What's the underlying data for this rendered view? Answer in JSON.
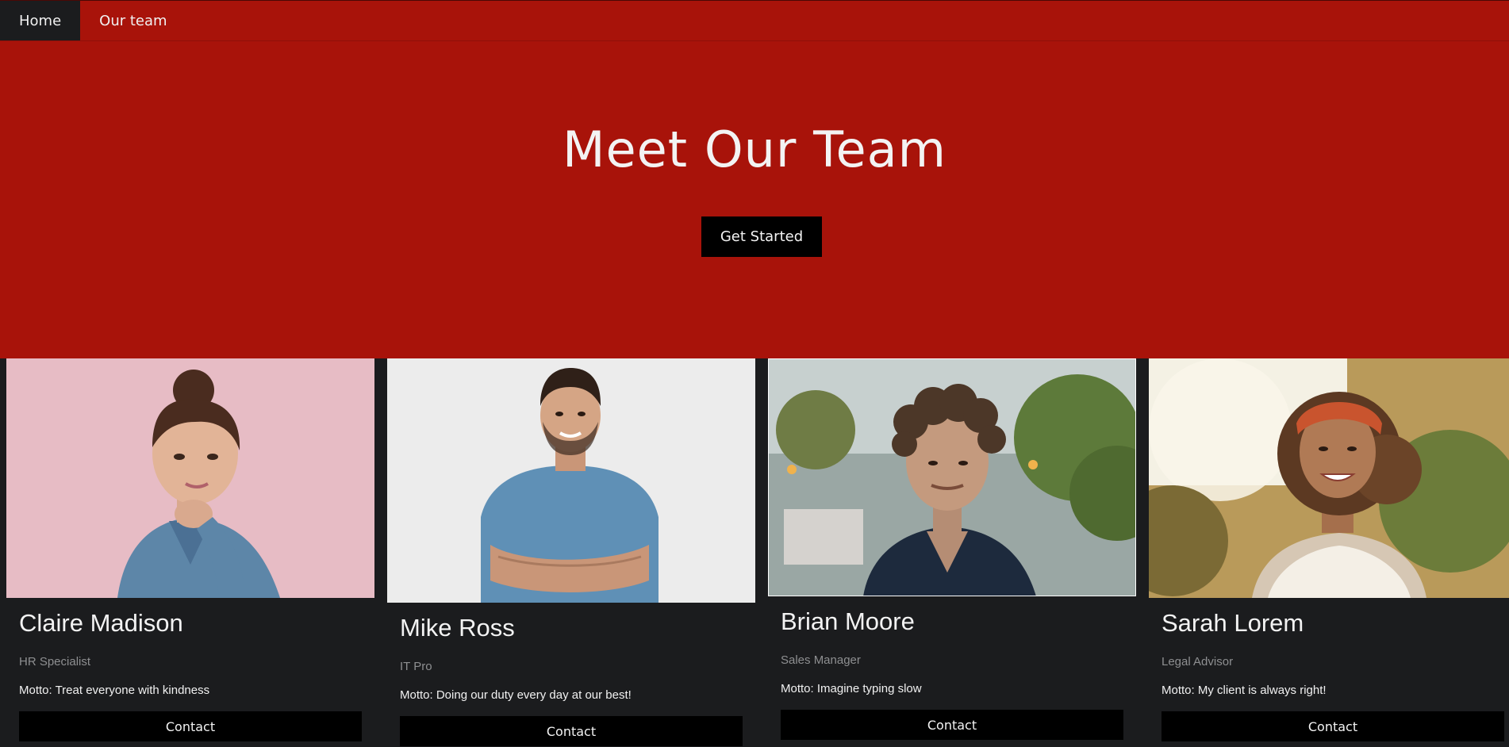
{
  "nav": {
    "items": [
      {
        "label": "Home",
        "active": true
      },
      {
        "label": "Our team",
        "active": false
      }
    ]
  },
  "hero": {
    "title": "Meet Our Team",
    "button_label": "Get Started"
  },
  "team": [
    {
      "name": "Claire Madison",
      "role": "HR Specialist",
      "motto": "Motto: Treat everyone with kindness",
      "contact_label": "Contact"
    },
    {
      "name": "Mike Ross",
      "role": "IT Pro",
      "motto": "Motto: Doing our duty every day at our best!",
      "contact_label": "Contact"
    },
    {
      "name": "Brian Moore",
      "role": "Sales Manager",
      "motto": "Motto: Imagine typing slow",
      "contact_label": "Contact"
    },
    {
      "name": "Sarah Lorem",
      "role": "Legal Advisor",
      "motto": "Motto: My client is always right!",
      "contact_label": "Contact"
    }
  ],
  "colors": {
    "brand_red": "#a8130a",
    "dark_bg": "#1b1c1e",
    "button_black": "#000000"
  }
}
